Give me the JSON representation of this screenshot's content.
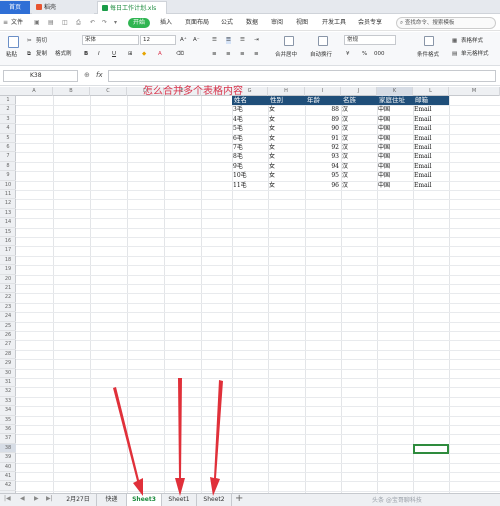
{
  "titlebar": {
    "home_tab": "首页",
    "shell_tab": "稻壳",
    "file_tab": "每日工作计划.xls"
  },
  "menubar": {
    "file": "文件",
    "start": "开始",
    "insert": "插入",
    "layout": "页面布局",
    "formula": "公式",
    "data": "数据",
    "review": "审阅",
    "view": "视图",
    "dev": "开发工具",
    "member": "会员专享",
    "search_placeholder": "查找命令、搜索模板"
  },
  "ribbon": {
    "paste": "粘贴",
    "cut": "剪切",
    "copy": "复制",
    "format_painter": "格式刷",
    "font_name": "宋体",
    "font_size": "12",
    "bold": "B",
    "italic": "I",
    "underline": "U",
    "merge_center": "合并居中",
    "wrap_text": "自动换行",
    "number_format": "常规",
    "percent": "%",
    "thousands": "000",
    "cond_format": "条件格式",
    "table_style": "表格样式",
    "cell_style": "单元格样式"
  },
  "formula_bar": {
    "cell_ref": "K38",
    "fx": "fx",
    "value": ""
  },
  "grid": {
    "columns": [
      "A",
      "B",
      "C",
      "D",
      "E",
      "F",
      "G",
      "H",
      "I",
      "J",
      "K",
      "L",
      "M"
    ],
    "rows": [
      "1",
      "2",
      "3",
      "4",
      "5",
      "6",
      "7",
      "8",
      "9",
      "10",
      "11",
      "12",
      "13",
      "14",
      "15",
      "16",
      "17",
      "18",
      "19",
      "20",
      "21",
      "22",
      "23",
      "24",
      "25",
      "26",
      "27",
      "28",
      "29",
      "30",
      "31",
      "32",
      "33",
      "34",
      "35",
      "36",
      "37",
      "38",
      "39",
      "40",
      "41",
      "42"
    ],
    "annotation": "怎么合并多个表格内容",
    "headers": [
      "姓名",
      "性别",
      "年龄",
      "名族",
      "家庭住址",
      "邮箱"
    ],
    "records": [
      {
        "name": "3毛",
        "gender": "女",
        "age": "88",
        "ethnic": "汉",
        "addr": "中国",
        "email": "Email"
      },
      {
        "name": "4毛",
        "gender": "女",
        "age": "89",
        "ethnic": "汉",
        "addr": "中国",
        "email": "Email"
      },
      {
        "name": "5毛",
        "gender": "女",
        "age": "90",
        "ethnic": "汉",
        "addr": "中国",
        "email": "Email"
      },
      {
        "name": "6毛",
        "gender": "女",
        "age": "91",
        "ethnic": "汉",
        "addr": "中国",
        "email": "Email"
      },
      {
        "name": "7毛",
        "gender": "女",
        "age": "92",
        "ethnic": "汉",
        "addr": "中国",
        "email": "Email"
      },
      {
        "name": "8毛",
        "gender": "女",
        "age": "93",
        "ethnic": "汉",
        "addr": "中国",
        "email": "Email"
      },
      {
        "name": "9毛",
        "gender": "女",
        "age": "94",
        "ethnic": "汉",
        "addr": "中国",
        "email": "Email"
      },
      {
        "name": "10毛",
        "gender": "女",
        "age": "95",
        "ethnic": "汉",
        "addr": "中国",
        "email": "Email"
      },
      {
        "name": "11毛",
        "gender": "女",
        "age": "96",
        "ethnic": "汉",
        "addr": "中国",
        "email": "Email"
      }
    ]
  },
  "sheets": [
    "2月27日",
    "快递",
    "Sheet3",
    "Sheet1",
    "Sheet2"
  ],
  "active_sheet": "Sheet3",
  "add_sheet": "+",
  "watermark": "头条 @宝哥聊科技"
}
